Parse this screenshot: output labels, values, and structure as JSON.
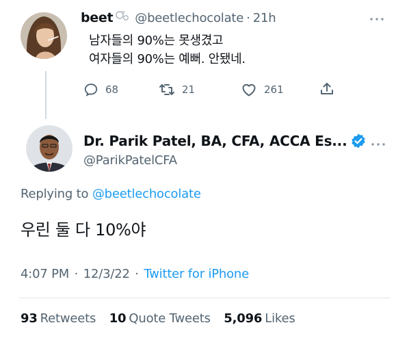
{
  "tweet1": {
    "name": "beet",
    "handle": "@beetlechocolate",
    "separator": "·",
    "time": "21h",
    "lines": [
      "남자들의 90%는 못생겼고",
      "여자들의 90%는 예뻐. 안됐네."
    ],
    "reply_count": "68",
    "retweet_count": "21",
    "like_count": "261"
  },
  "tweet2": {
    "name": "Dr. Parik Patel, BA, CFA, ACCA Es...",
    "handle": "@ParikPatelCFA",
    "replying_prefix": "Replying to",
    "replying_handle": "@beetlechocolate",
    "text": "우린 둘 다 10%야",
    "time": "4:07 PM",
    "sep1": "·",
    "date": "12/3/22",
    "sep2": "·",
    "source": "Twitter for iPhone"
  },
  "stats": {
    "retweets_count": "93",
    "retweets_label": "Retweets",
    "quotes_count": "10",
    "quotes_label": "Quote Tweets",
    "likes_count": "5,096",
    "likes_label": "Likes"
  },
  "icons": {
    "more": "more-horizontal-icon",
    "verified": "verified-badge-icon",
    "reply": "reply-icon",
    "retweet": "retweet-icon",
    "like": "heart-icon",
    "share": "share-icon",
    "emoji": "bubbles-emoji-icon"
  },
  "colors": {
    "text": "#0f1419",
    "secondary": "#536471",
    "link": "#1d9bf0",
    "verified": "#1d9bf0",
    "divider": "#dfe4e8"
  }
}
